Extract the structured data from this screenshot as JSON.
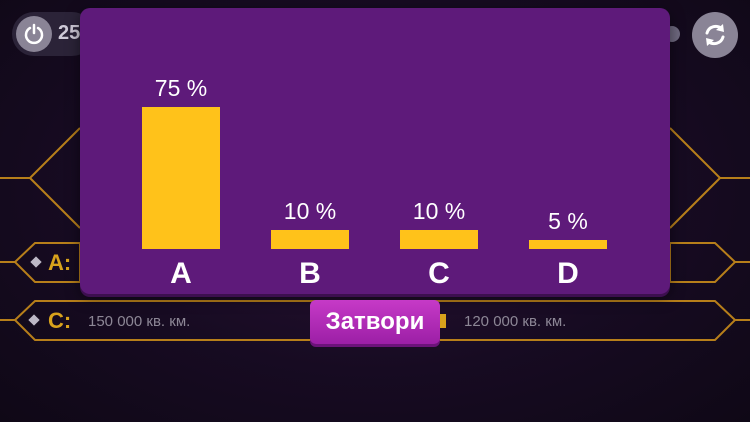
{
  "hud": {
    "score_partial": "25"
  },
  "answers": [
    {
      "letter": "A:",
      "text": ""
    },
    {
      "letter": "C:",
      "text": "150 000 кв. км."
    },
    {
      "letter": "",
      "text": "120 000 кв. км."
    }
  ],
  "audience_poll": {
    "close_label": "Затвори"
  },
  "chart_data": {
    "type": "bar",
    "categories": [
      "A",
      "B",
      "C",
      "D"
    ],
    "values": [
      75,
      10,
      10,
      5
    ],
    "value_labels": [
      "75 %",
      "10 %",
      "10 %",
      "5 %"
    ],
    "ylim": [
      0,
      100
    ],
    "bar_color": "#ffc21a"
  },
  "colors": {
    "modal_bg": "#5e1a7a",
    "bar": "#ffc21a",
    "close_button": "#b12db8",
    "gold_outline": "#b77f1a"
  }
}
